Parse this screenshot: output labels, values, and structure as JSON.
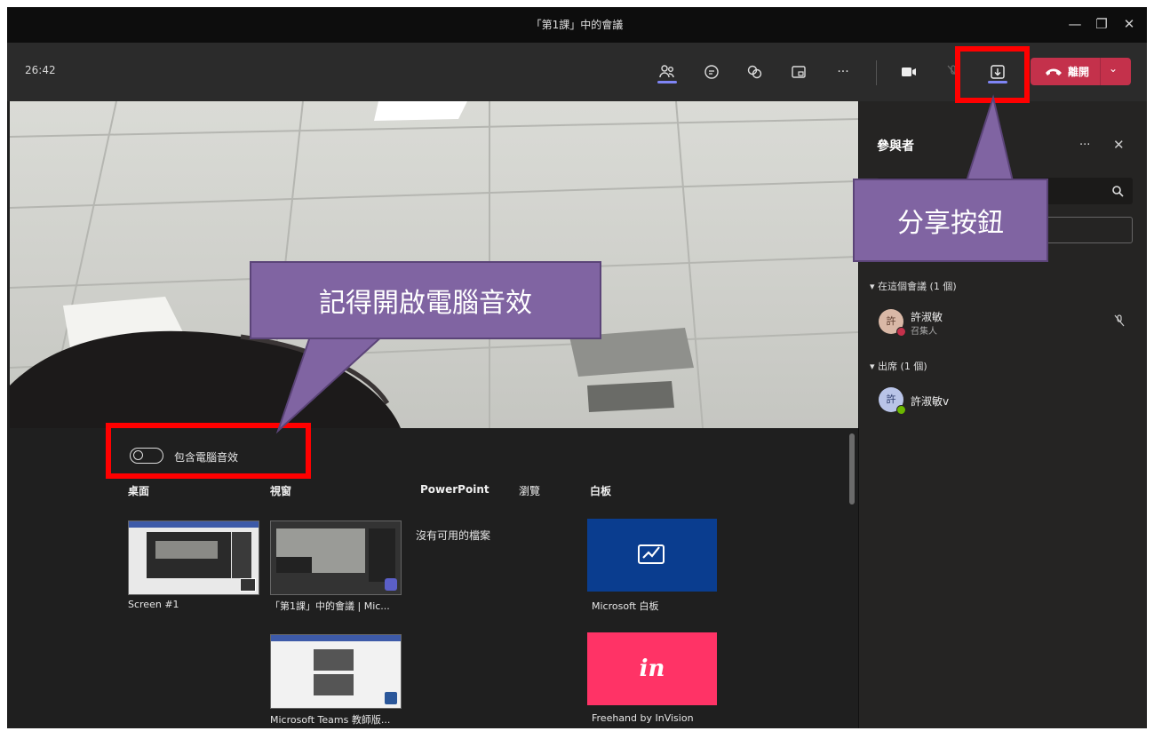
{
  "window": {
    "title": "「第1課」中的會議",
    "minimize": "—",
    "maximize": "❐",
    "close": "✕"
  },
  "toolbar": {
    "timer": "26:42",
    "more": "···",
    "hangup_label": "離開"
  },
  "share": {
    "toggle_label": "包含電腦音效",
    "tabs": [
      "桌面",
      "視窗",
      "PowerPoint",
      "瀏覽",
      "白板"
    ],
    "no_files": "沒有可用的檔案",
    "desktop_items": [
      "Screen #1"
    ],
    "window_items": [
      "「第1課」中的會議 | Mic...",
      "Microsoft Teams 教師版..."
    ],
    "whiteboard_items": [
      "Microsoft 白板",
      "Freehand by InVision"
    ]
  },
  "participants": {
    "title": "參與者",
    "more": "···",
    "in_meeting_header": "在這個會議 (1 個)",
    "attendees_header": "出席 (1 個)",
    "person_name": "許淑敏",
    "person_role": "召集人",
    "person_name2": "許淑敏v"
  },
  "annotations": {
    "share_button": "分享按鈕",
    "audio_reminder": "記得開啟電腦音效"
  },
  "colors": {
    "accent": "#7f85f5",
    "hangup": "#c4314b",
    "callout": "#8064a2",
    "highlight": "#ff0000",
    "whiteboard_blue": "#0a3d8f",
    "invision_pink": "#ff3366"
  }
}
